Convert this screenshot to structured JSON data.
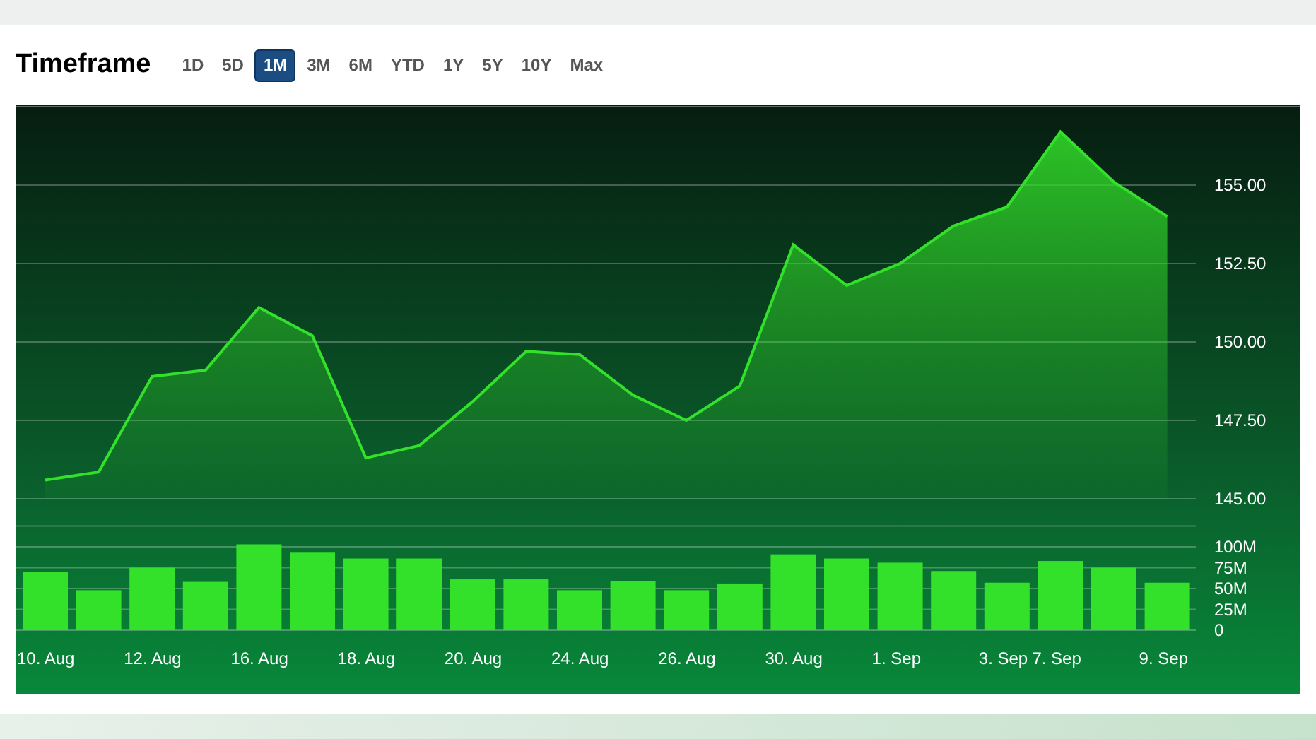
{
  "title": "Timeframe",
  "timeframes": [
    {
      "label": "1D",
      "selected": false
    },
    {
      "label": "5D",
      "selected": false
    },
    {
      "label": "1M",
      "selected": true
    },
    {
      "label": "3M",
      "selected": false
    },
    {
      "label": "6M",
      "selected": false
    },
    {
      "label": "YTD",
      "selected": false
    },
    {
      "label": "1Y",
      "selected": false
    },
    {
      "label": "5Y",
      "selected": false
    },
    {
      "label": "10Y",
      "selected": false
    },
    {
      "label": "Max",
      "selected": false
    }
  ],
  "price_chart": {
    "chart_data": {
      "type": "area",
      "grid": true,
      "ylim": [
        145,
        157.5
      ],
      "series": [
        {
          "color": "#33e02a",
          "values": [
            145.6,
            145.85,
            148.9,
            149.1,
            151.1,
            150.2,
            146.3,
            146.7,
            148.1,
            149.7,
            149.6,
            148.3,
            147.5,
            148.6,
            153.1,
            151.8,
            152.5,
            153.7,
            154.3,
            156.7,
            155.1,
            154.0
          ]
        }
      ],
      "yticks": [
        {
          "value": 145,
          "label": "145.00"
        },
        {
          "value": 147.5,
          "label": "147.50"
        },
        {
          "value": 150,
          "label": "150.00"
        },
        {
          "value": 152.5,
          "label": "152.50"
        },
        {
          "value": 155,
          "label": "155.00"
        }
      ]
    }
  },
  "volume_chart": {
    "chart_data": {
      "type": "bar",
      "grid": true,
      "ylim": [
        0,
        125
      ],
      "categories": [
        "10. Aug",
        null,
        "12. Aug",
        null,
        "16. Aug",
        null,
        "18. Aug",
        null,
        "20. Aug",
        null,
        "24. Aug",
        null,
        "26. Aug",
        null,
        "30. Aug",
        null,
        "1. Sep",
        null,
        "3. Sep",
        "7. Sep",
        null,
        "9. Sep"
      ],
      "series": [
        {
          "color": "#33e02a",
          "values": [
            70,
            48,
            75,
            58,
            103,
            93,
            86,
            86,
            61,
            61,
            48,
            59,
            48,
            56,
            91,
            86,
            81,
            71,
            57,
            83,
            75,
            57
          ]
        }
      ],
      "yticks": [
        {
          "value": 0,
          "label": "0"
        },
        {
          "value": 25,
          "label": "25M"
        },
        {
          "value": 50,
          "label": "50M"
        },
        {
          "value": 75,
          "label": "75M"
        },
        {
          "value": 100,
          "label": "100M"
        }
      ]
    }
  }
}
